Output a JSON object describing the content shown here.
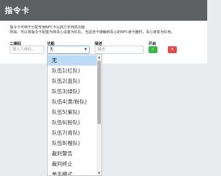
{
  "header": {
    "title": "指令卡"
  },
  "description": {
    "line1": "指令卡可用于分配专用NFC卡以执行手持机功能",
    "line2": "例如，可以将指令卡配置为将青心设置为红队。当这张卡接触到青心的NFC读卡器时，青心将变为红色。"
  },
  "form": {
    "nfc_label": "二维码",
    "nfc_placeholder": "输入二维码...",
    "function_label": "功能",
    "function_value": "无",
    "desc_label": "描述",
    "desc_placeholder": "描述",
    "enable_label": "开启"
  },
  "dropdown": {
    "options": [
      "无",
      "队伍1(红队)",
      "队伍2(蓝队)",
      "队伍3(绿队)",
      "队伍4(黄/粉队)",
      "队伍5(紫队)",
      "队伍6(粉队)",
      "队伍7(青队)",
      "队伍8(橙队)",
      "裁判警告",
      "裁判终止",
      "单手模式"
    ]
  },
  "icons": {
    "chevron": "chevron-down-icon",
    "check": "check-icon",
    "delete": "delete-icon"
  }
}
